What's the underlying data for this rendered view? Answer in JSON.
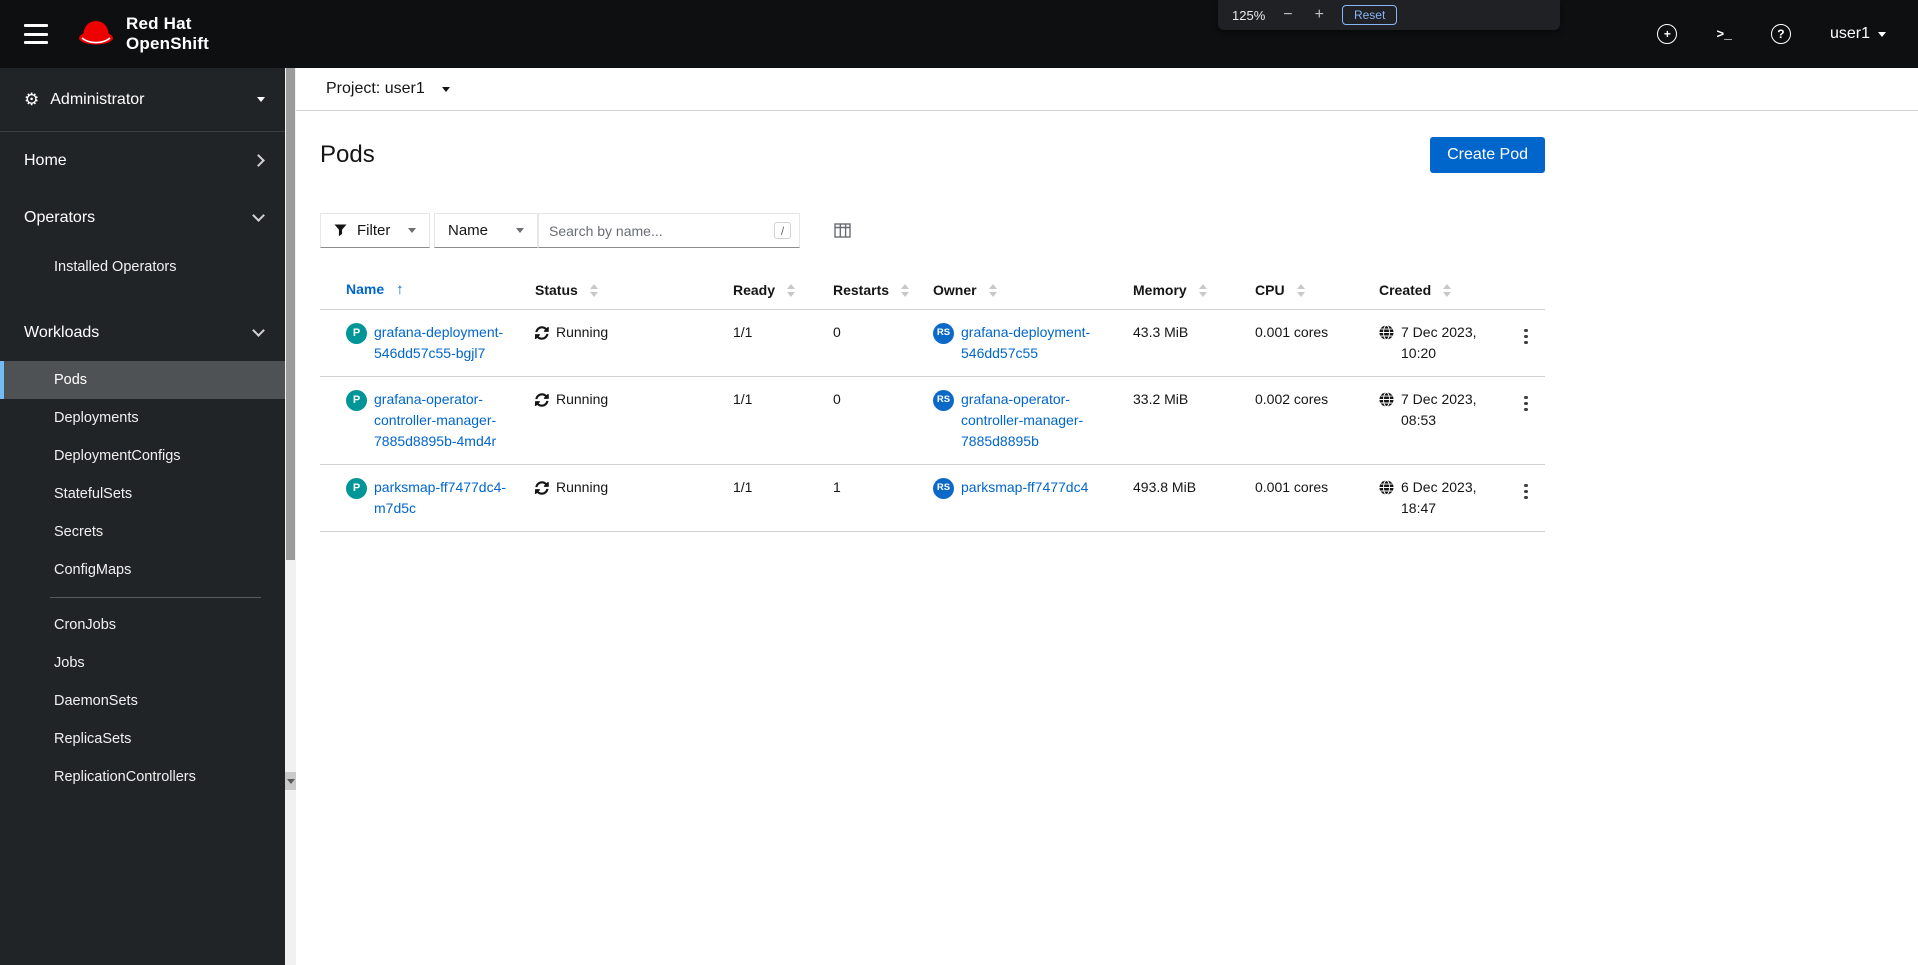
{
  "masthead": {
    "brand": {
      "line1": "Red Hat",
      "line2": "OpenShift"
    },
    "user_menu": "user1"
  },
  "icons": {
    "gear": "⚙",
    "quick_create": "+",
    "terminal": ">_",
    "help": "?",
    "sort_asc": "↑"
  },
  "zoom_overlay": {
    "level": "125%",
    "minus": "−",
    "plus": "+",
    "reset": "Reset"
  },
  "sidebar": {
    "perspective": "Administrator",
    "home": "Home",
    "operators": {
      "label": "Operators",
      "children": [
        "Installed Operators"
      ]
    },
    "workloads": {
      "label": "Workloads",
      "children": [
        "Pods",
        "Deployments",
        "DeploymentConfigs",
        "StatefulSets",
        "Secrets",
        "ConfigMaps",
        "CronJobs",
        "Jobs",
        "DaemonSets",
        "ReplicaSets",
        "ReplicationControllers"
      ]
    }
  },
  "project_bar": {
    "label": "Project: user1"
  },
  "page": {
    "title": "Pods",
    "create_button": "Create Pod"
  },
  "toolbar": {
    "filter": "Filter",
    "search_attribute": "Name",
    "search_placeholder": "Search by name...",
    "search_shortcut": "/"
  },
  "table": {
    "columns": {
      "name": "Name",
      "status": "Status",
      "ready": "Ready",
      "restarts": "Restarts",
      "owner": "Owner",
      "memory": "Memory",
      "cpu": "CPU",
      "created": "Created"
    },
    "badges": {
      "pod": "P",
      "replicaset": "RS"
    },
    "rows": [
      {
        "name": "grafana-deployment-546dd57c55-bgjl7",
        "status": "Running",
        "ready": "1/1",
        "restarts": "0",
        "owner": "grafana-deployment-546dd57c55",
        "memory": "43.3 MiB",
        "cpu": "0.001 cores",
        "created": "7 Dec 2023, 10:20"
      },
      {
        "name": "grafana-operator-controller-manager-7885d8895b-4md4r",
        "status": "Running",
        "ready": "1/1",
        "restarts": "0",
        "owner": "grafana-operator-controller-manager-7885d8895b",
        "memory": "33.2 MiB",
        "cpu": "0.002 cores",
        "created": "7 Dec 2023, 08:53"
      },
      {
        "name": "parksmap-ff7477dc4-m7d5c",
        "status": "Running",
        "ready": "1/1",
        "restarts": "1",
        "owner": "parksmap-ff7477dc4",
        "memory": "493.8 MiB",
        "cpu": "0.001 cores",
        "created": "6 Dec 2023, 18:47"
      }
    ]
  },
  "colors": {
    "accent": "#0066cc",
    "masthead_bg": "#0d0f11",
    "sidebar_bg": "#212427",
    "sidebar_selected_bg": "#4f5255",
    "sidebar_selected_border": "#73bcf7",
    "pod_badge": "#009596",
    "replicaset_badge": "#0c69c8",
    "brand_red": "#ee0000"
  }
}
